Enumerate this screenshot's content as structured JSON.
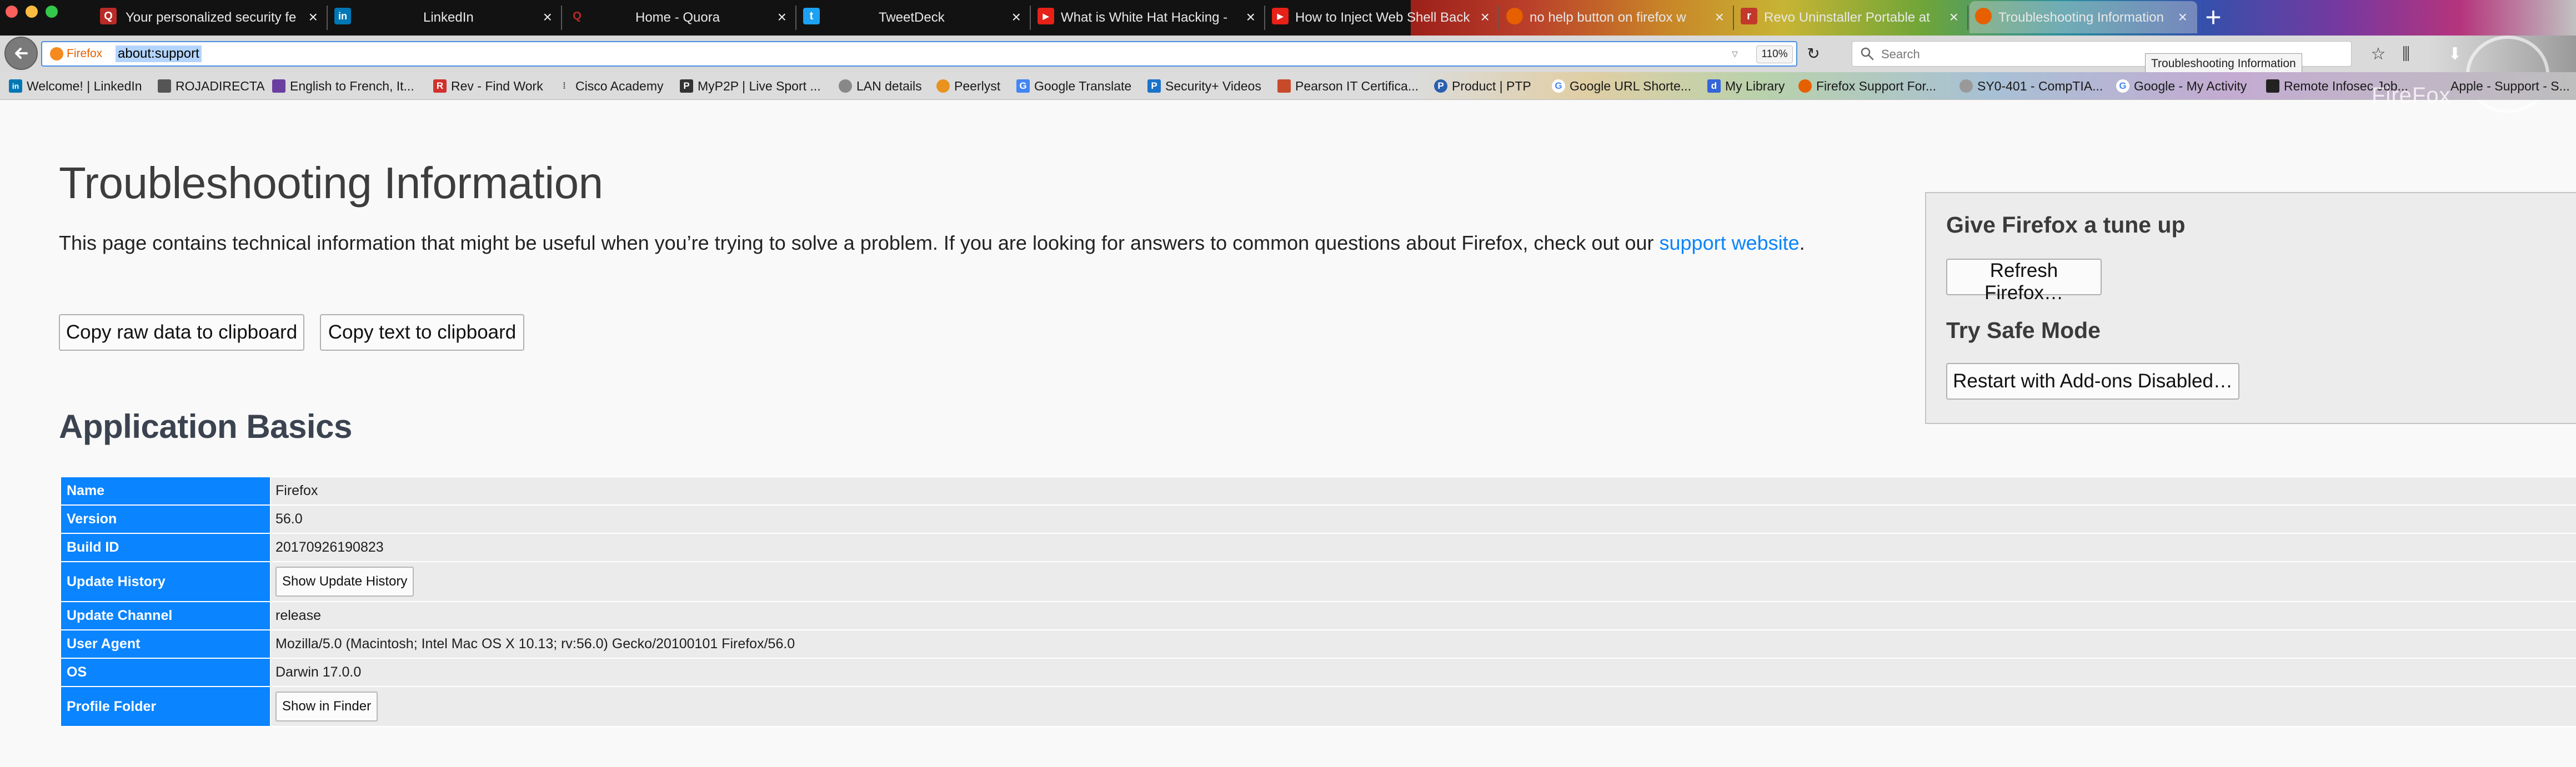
{
  "browser": {
    "tabs": [
      {
        "title": "Your personalized security fe",
        "favicon": "quora-icon",
        "color": "#b92b27"
      },
      {
        "title": "LinkedIn",
        "favicon": "linkedin-icon",
        "color": "#0077b5"
      },
      {
        "title": "Home - Quora",
        "favicon": "quora-icon",
        "color": "#b92b27"
      },
      {
        "title": "TweetDeck",
        "favicon": "twitter-icon",
        "color": "#1da1f2"
      },
      {
        "title": "What is White Hat Hacking -",
        "favicon": "youtube-icon",
        "color": "#e62117"
      },
      {
        "title": "How to Inject Web Shell Back",
        "favicon": "youtube-icon",
        "color": "#e62117"
      },
      {
        "title": "no help button on firefox w",
        "favicon": "firefox-icon",
        "color": "#e66000"
      },
      {
        "title": "Revo Uninstaller Portable at",
        "favicon": "revo-icon",
        "color": "#c0392b"
      },
      {
        "title": "Troubleshooting Information",
        "favicon": "firefox-icon",
        "color": "#e66000",
        "selected": true
      }
    ],
    "identity_label": "Firefox",
    "url": "about:support",
    "zoom": "110%",
    "search_placeholder": "Search",
    "tooltip": "Troubleshooting Information",
    "watermark": "FireFox"
  },
  "bookmarks": [
    {
      "label": "Welcome! | LinkedIn",
      "icon": "linkedin-icon"
    },
    {
      "label": "ROJADIRECTA",
      "icon": "tv-icon"
    },
    {
      "label": "English to French, It...",
      "icon": "translate-icon"
    },
    {
      "label": "Rev - Find Work",
      "icon": "rev-icon"
    },
    {
      "label": "Cisco Academy",
      "icon": "cisco-icon"
    },
    {
      "label": "MyP2P | Live Sport ...",
      "icon": "p2p-icon"
    },
    {
      "label": "LAN details",
      "icon": "globe-icon"
    },
    {
      "label": "Peerlyst",
      "icon": "peerlyst-icon"
    },
    {
      "label": "Google Translate",
      "icon": "google-translate-icon"
    },
    {
      "label": "Security+ Videos",
      "icon": "professor-icon"
    },
    {
      "label": "Pearson IT Certifica...",
      "icon": "pearson-icon"
    },
    {
      "label": "Product | PTP",
      "icon": "ptp-icon"
    },
    {
      "label": "Google URL Shorte...",
      "icon": "google-icon"
    },
    {
      "label": "My Library",
      "icon": "library-icon"
    },
    {
      "label": "Firefox Support For...",
      "icon": "firefox-icon"
    },
    {
      "label": "SY0-401 - CompTIA...",
      "icon": "globe-icon"
    },
    {
      "label": "Google - My Activity",
      "icon": "google-icon"
    },
    {
      "label": "Remote Infosec Job...",
      "icon": "infosec-icon"
    },
    {
      "label": "Apple - Support - S...",
      "icon": "apple-icon"
    }
  ],
  "page": {
    "title": "Troubleshooting Information",
    "intro_text": "This page contains technical information that might be useful when you’re trying to solve a problem. If you are looking for answers to common questions about Firefox, check out our ",
    "intro_link": "support website",
    "intro_end": ".",
    "copy_raw_label": "Copy raw data to clipboard",
    "copy_text_label": "Copy text to clipboard"
  },
  "sidebar": {
    "tuneup_heading": "Give Firefox a tune up",
    "refresh_label": "Refresh Firefox…",
    "safe_mode_heading": "Try Safe Mode",
    "restart_label": "Restart with Add-ons Disabled…"
  },
  "application_basics": {
    "heading": "Application Basics",
    "rows": [
      {
        "label": "Name",
        "value": "Firefox"
      },
      {
        "label": "Version",
        "value": "56.0"
      },
      {
        "label": "Build ID",
        "value": "20170926190823"
      },
      {
        "label": "Update History",
        "button": "Show Update History"
      },
      {
        "label": "Update Channel",
        "value": "release"
      },
      {
        "label": "User Agent",
        "value": "Mozilla/5.0 (Macintosh; Intel Mac OS X 10.13; rv:56.0) Gecko/20100101 Firefox/56.0"
      },
      {
        "label": "OS",
        "value": "Darwin 17.0.0"
      },
      {
        "label": "Profile Folder",
        "button": "Show in Finder"
      }
    ]
  },
  "colors": {
    "accent_blue": "#0a84ff",
    "table_cell": "#ebebeb",
    "heading": "#3c4350"
  }
}
